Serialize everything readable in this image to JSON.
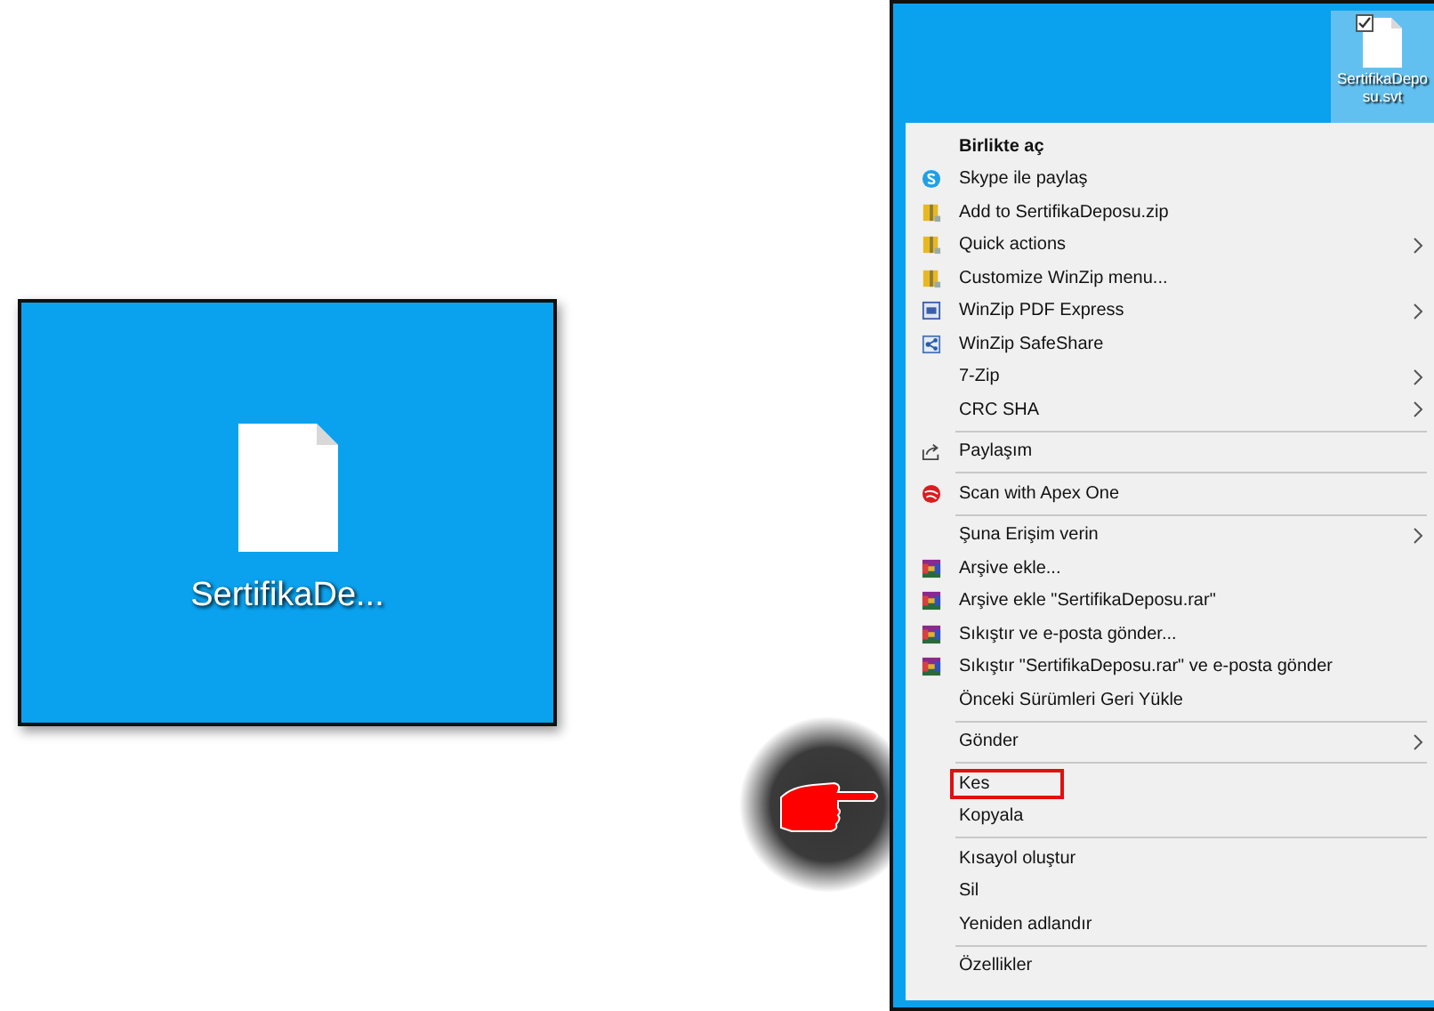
{
  "left_desktop": {
    "file_label": "SertifikaDe..."
  },
  "right_desktop": {
    "file_label_lines": [
      "SertifikaDepo",
      "su.svt"
    ],
    "file_selected": true,
    "file_checked": true
  },
  "context_menu": {
    "groups": [
      {
        "items": [
          {
            "label": "Birlikte aç",
            "bold": true,
            "submenu": false,
            "highlighted": false
          },
          {
            "label": "Skype ile paylaş",
            "kind": "skype",
            "submenu": false,
            "highlighted": false
          },
          {
            "label": "Add to SertifikaDeposu.zip",
            "kind": "winzip",
            "submenu": false,
            "highlighted": false
          },
          {
            "label": "Quick actions",
            "kind": "winzip",
            "submenu": true,
            "highlighted": false
          },
          {
            "label": "Customize WinZip menu...",
            "kind": "winzip",
            "submenu": false,
            "highlighted": false
          },
          {
            "label": "WinZip PDF Express",
            "kind": "pdf",
            "submenu": true,
            "highlighted": false
          },
          {
            "label": "WinZip SafeShare",
            "kind": "safeshare",
            "submenu": false,
            "highlighted": false
          },
          {
            "label": "7-Zip",
            "submenu": true,
            "highlighted": false
          },
          {
            "label": "CRC SHA",
            "submenu": true,
            "highlighted": false
          }
        ]
      },
      {
        "items": [
          {
            "label": "Paylaşım",
            "kind": "share",
            "submenu": false,
            "highlighted": false
          }
        ]
      },
      {
        "items": [
          {
            "label": "Scan with Apex One",
            "kind": "apex",
            "submenu": false,
            "highlighted": false
          }
        ]
      },
      {
        "items": [
          {
            "label": "Şuna Erişim verin",
            "submenu": true,
            "highlighted": false
          },
          {
            "label": "Arşive ekle...",
            "kind": "winrar",
            "submenu": false,
            "highlighted": false
          },
          {
            "label": "Arşive ekle \"SertifikaDeposu.rar\"",
            "kind": "winrar",
            "submenu": false,
            "highlighted": false
          },
          {
            "label": "Sıkıştır ve e-posta gönder...",
            "kind": "winrar",
            "submenu": false,
            "highlighted": false
          },
          {
            "label": "Sıkıştır \"SertifikaDeposu.rar\" ve e-posta gönder",
            "kind": "winrar",
            "submenu": false,
            "highlighted": false
          },
          {
            "label": "Önceki Sürümleri Geri Yükle",
            "submenu": false,
            "highlighted": false
          }
        ]
      },
      {
        "items": [
          {
            "label": "Gönder",
            "submenu": true,
            "highlighted": false
          }
        ]
      },
      {
        "items": [
          {
            "label": "Kes",
            "submenu": false,
            "highlighted": true
          },
          {
            "label": "Kopyala",
            "submenu": false,
            "highlighted": false
          }
        ]
      },
      {
        "items": [
          {
            "label": "Kısayol oluştur",
            "submenu": false,
            "highlighted": false
          },
          {
            "label": "Sil",
            "submenu": false,
            "highlighted": false
          },
          {
            "label": "Yeniden adlandır",
            "submenu": false,
            "highlighted": false
          }
        ]
      },
      {
        "items": [
          {
            "label": "Özellikler",
            "submenu": false,
            "highlighted": false
          }
        ]
      }
    ]
  }
}
